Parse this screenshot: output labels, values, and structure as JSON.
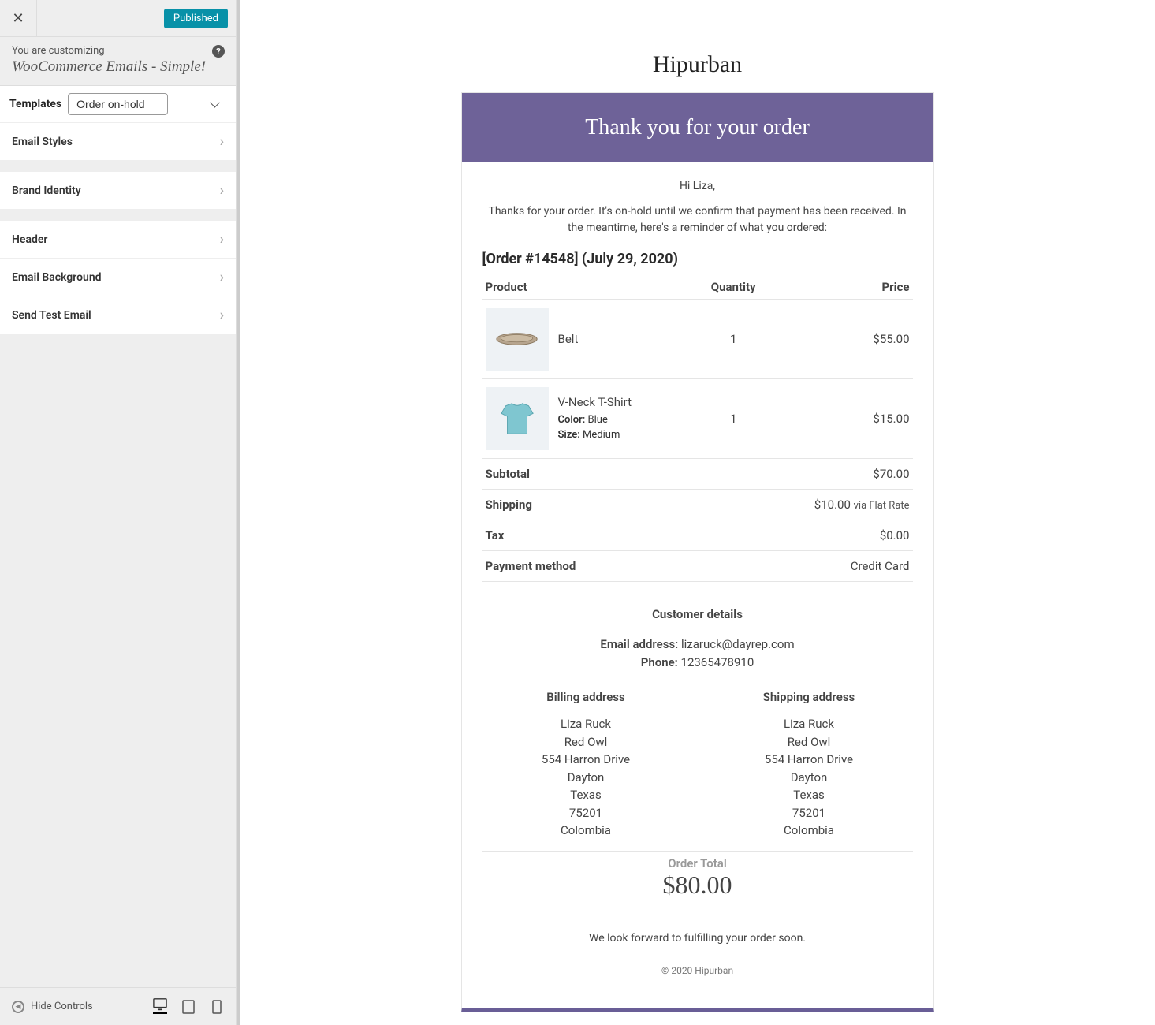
{
  "sidebar": {
    "published_label": "Published",
    "customizing_label": "You are customizing",
    "customizing_title": "WooCommerce Emails - Simple!",
    "templates_label": "Templates",
    "templates_selected": "Order on-hold",
    "items1": [
      "Email Styles"
    ],
    "items2": [
      "Brand Identity"
    ],
    "items3": [
      "Header",
      "Email Background",
      "Send Test Email"
    ],
    "hide_controls_label": "Hide Controls"
  },
  "email": {
    "brand": "Hipurban",
    "header": "Thank you for your order",
    "greeting": "Hi Liza,",
    "intro": "Thanks for your order. It's on-hold until we confirm that payment has been received. In the meantime, here's a reminder of what you ordered:",
    "order_heading": "[Order #14548] (July 29, 2020)",
    "columns": {
      "product": "Product",
      "quantity": "Quantity",
      "price": "Price"
    },
    "items": [
      {
        "name": "Belt",
        "qty": "1",
        "price": "$55.00",
        "attrs": []
      },
      {
        "name": "V-Neck T-Shirt",
        "qty": "1",
        "price": "$15.00",
        "attrs": [
          {
            "label": "Color:",
            "value": "Blue"
          },
          {
            "label": "Size:",
            "value": "Medium"
          }
        ]
      }
    ],
    "summary": [
      {
        "label": "Subtotal",
        "value": "$70.00",
        "via": ""
      },
      {
        "label": "Shipping",
        "value": "$10.00",
        "via": "via Flat Rate"
      },
      {
        "label": "Tax",
        "value": "$0.00",
        "via": ""
      },
      {
        "label": "Payment method",
        "value": "Credit Card",
        "via": ""
      }
    ],
    "customer": {
      "heading": "Customer details",
      "email_label": "Email address:",
      "email_value": "lizaruck@dayrep.com",
      "phone_label": "Phone:",
      "phone_value": "12365478910"
    },
    "addresses": {
      "billing_label": "Billing address",
      "shipping_label": "Shipping address",
      "billing": [
        "Liza Ruck",
        "Red Owl",
        "554 Harron Drive",
        "Dayton",
        "Texas",
        "75201",
        "Colombia"
      ],
      "shipping": [
        "Liza Ruck",
        "Red Owl",
        "554 Harron Drive",
        "Dayton",
        "Texas",
        "75201",
        "Colombia"
      ]
    },
    "total": {
      "label": "Order Total",
      "amount": "$80.00"
    },
    "outro": "We look forward to fulfilling your order soon.",
    "footer": "© 2020 Hipurban"
  }
}
